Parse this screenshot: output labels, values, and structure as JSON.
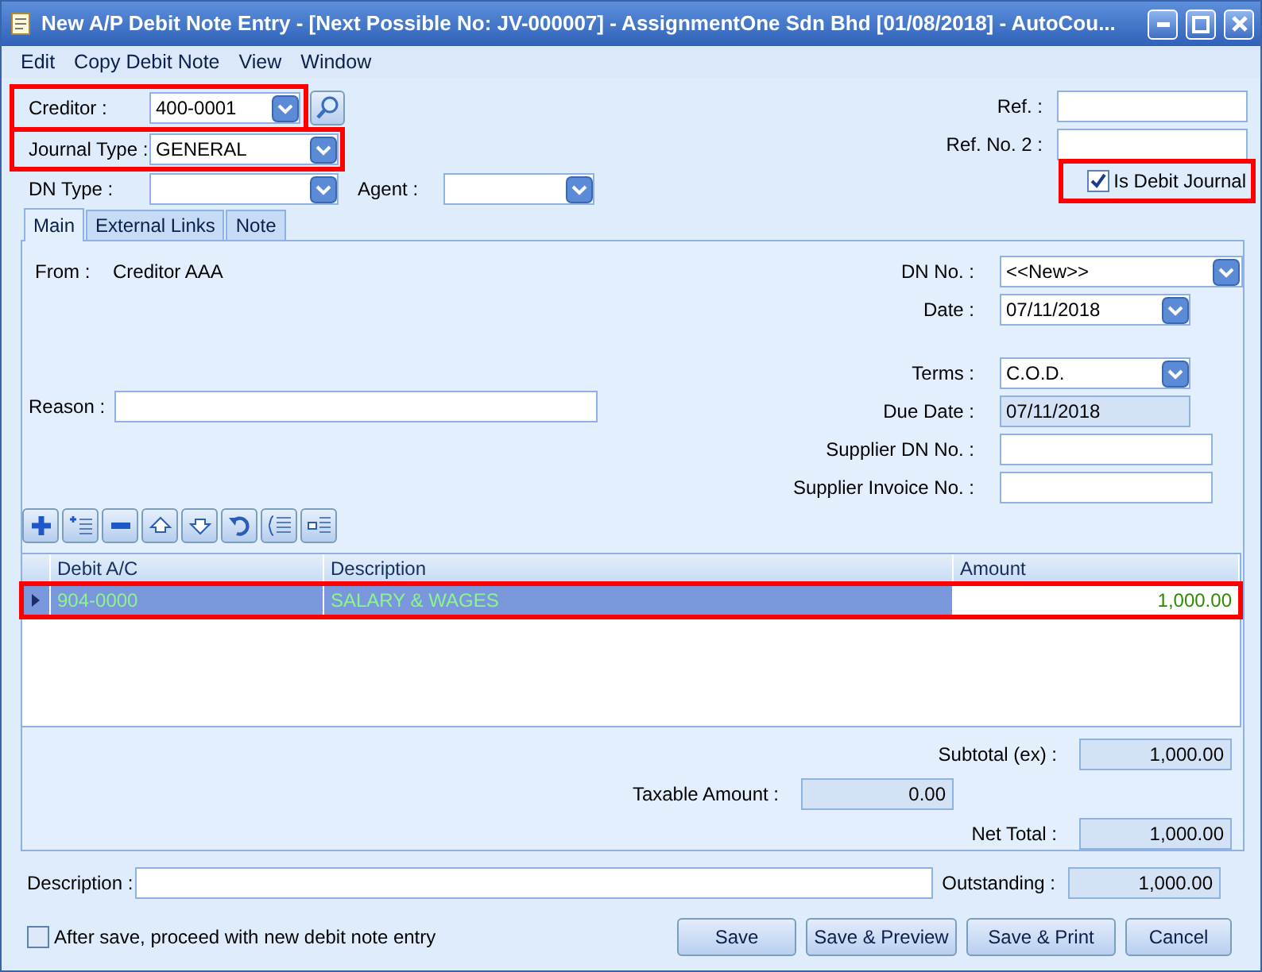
{
  "window": {
    "title": "New A/P Debit Note Entry - [Next Possible No: JV-000007] - AssignmentOne Sdn Bhd [01/08/2018] - AutoCou..."
  },
  "menu": [
    {
      "label": "Edit"
    },
    {
      "label": "Copy Debit Note"
    },
    {
      "label": "View"
    },
    {
      "label": "Window"
    }
  ],
  "header": {
    "creditor": {
      "label": "Creditor :",
      "value": "400-0001",
      "highlighted": true
    },
    "journal_type": {
      "label": "Journal Type :",
      "value": "GENERAL",
      "highlighted": true
    },
    "dn_type": {
      "label": "DN Type :"
    },
    "agent": {
      "label": "Agent :"
    },
    "ref": {
      "label": "Ref. :"
    },
    "ref_no_2": {
      "label": "Ref. No. 2 :"
    },
    "is_debit_journal": {
      "label": "Is Debit Journal",
      "checked": true,
      "highlighted": true
    }
  },
  "tabs": [
    {
      "label": "Main",
      "selected": true
    },
    {
      "label": "External Links",
      "selected": false
    },
    {
      "label": "Note",
      "selected": false
    }
  ],
  "main": {
    "from_label": "From :",
    "from_value": "Creditor AAA",
    "reason_label": "Reason :",
    "field_groups": [
      [
        {
          "label": "DN No. :",
          "value": "<<New>>",
          "kind": "lookup"
        },
        {
          "label": "Date :",
          "value": "07/11/2018",
          "kind": "combo"
        }
      ],
      [
        {
          "label": "Terms :",
          "value": "C.O.D.",
          "kind": "combo"
        },
        {
          "label": "Due Date :",
          "value": "07/11/2018",
          "kind": "readonly"
        },
        {
          "label": "Supplier DN No. :",
          "kind": "text"
        },
        {
          "label": "Supplier Invoice No. :",
          "kind": "text"
        }
      ]
    ]
  },
  "grid": {
    "columns": [
      "Debit A/C",
      "Description",
      "Amount"
    ],
    "rows": [
      {
        "cells": [
          "904-0000",
          "SALARY & WAGES",
          "1,000.00"
        ],
        "selected": true,
        "highlighted": true
      }
    ]
  },
  "totals": {
    "subtotal": {
      "label": "Subtotal (ex) :",
      "value": "1,000.00"
    },
    "taxable": {
      "label": "Taxable Amount :",
      "value": "0.00"
    },
    "net_total": {
      "label": "Net Total :",
      "value": "1,000.00"
    }
  },
  "footer": {
    "description_label": "Description :",
    "outstanding": {
      "label": "Outstanding :",
      "value": "1,000.00"
    },
    "proceed": {
      "label": "After save, proceed with new debit note entry",
      "checked": false
    },
    "buttons": [
      "Save",
      "Save & Preview",
      "Save & Print",
      "Cancel"
    ]
  }
}
